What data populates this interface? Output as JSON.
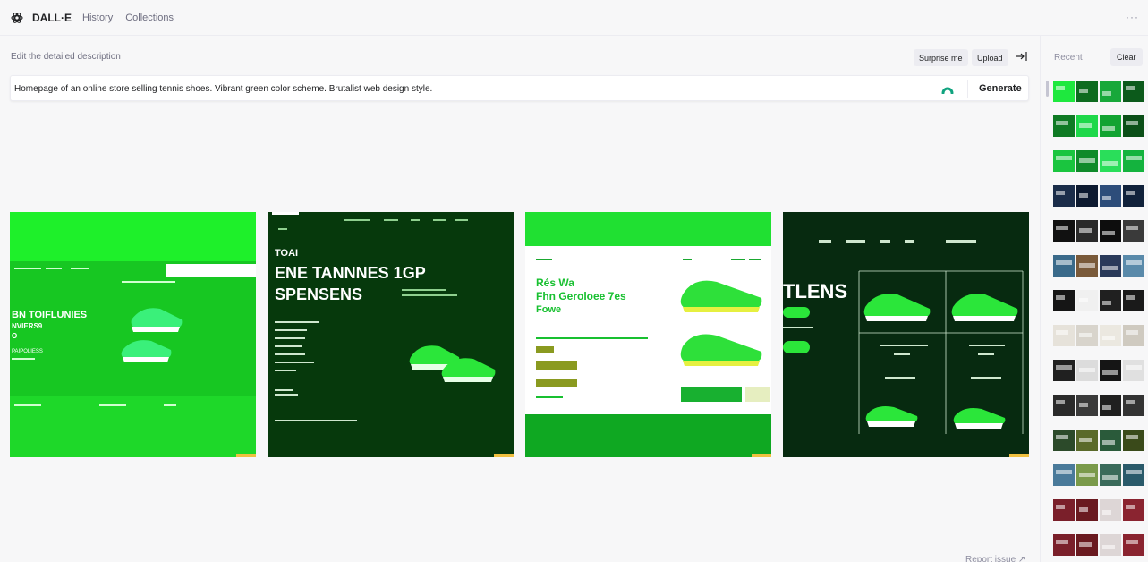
{
  "nav": {
    "brand": "DALL·E",
    "links": [
      "History",
      "Collections"
    ],
    "menu": "···"
  },
  "editor": {
    "label": "Edit the detailed description",
    "surprise_label": "Surprise me",
    "upload_label": "Upload",
    "prompt": "Homepage of an online store selling tennis shoes. Vibrant green color scheme. Brutalist web design style.",
    "generate_label": "Generate"
  },
  "results": [
    {
      "name": "result-1",
      "texts": [
        "BN TOIFLUNIES",
        "NVIERS9",
        "O",
        "PAIPOLIESS"
      ]
    },
    {
      "name": "result-2",
      "texts": [
        "TOAI",
        "ENE TANNNES 1GP",
        "SPENSENS"
      ]
    },
    {
      "name": "result-3",
      "texts": [
        "Rés Wa",
        "Fhn Geroloee 7es",
        "Fowe"
      ]
    },
    {
      "name": "result-4",
      "texts": [
        "TLENS"
      ]
    }
  ],
  "footer": {
    "report_label": "Report issue"
  },
  "sidebar": {
    "recent_label": "Recent",
    "clear_label": "Clear",
    "history": [
      [
        "#1ee83e",
        "#0d6b1f",
        "#18a83a",
        "#0c5a1b"
      ],
      [
        "#0f7a24",
        "#1ed84a",
        "#12a332",
        "#0b4f18"
      ],
      [
        "#1ac53f",
        "#0f8a2a",
        "#2ade5a",
        "#14b33e"
      ],
      [
        "#1b2d4a",
        "#0d1a30",
        "#2d4d7a",
        "#11223b"
      ],
      [
        "#111111",
        "#2a2a2a",
        "#0d0d0d",
        "#3a3a3a"
      ],
      [
        "#3a6a8a",
        "#7a5a3a",
        "#2a3a5a",
        "#5a8aaa"
      ],
      [
        "#151515",
        "#f0f0f0",
        "#202020",
        "#1a1a1a"
      ],
      [
        "#e6e2da",
        "#d8d4cc",
        "#ebe8e0",
        "#cfcac0"
      ],
      [
        "#202020",
        "#dcdcdc",
        "#151515",
        "#e0e0e0"
      ],
      [
        "#2a2a2a",
        "#3a3a3a",
        "#1f1f1f",
        "#333333"
      ],
      [
        "#2c4a2a",
        "#5a6a2a",
        "#2a5a3a",
        "#3a4a1a"
      ],
      [
        "#4a7a9a",
        "#7a9a4a",
        "#3a6a5a",
        "#2a5a6a"
      ],
      [
        "#7a1f2a",
        "#6a1a20",
        "#ddd6d6",
        "#8a2430"
      ],
      [
        "#7a1f2a",
        "#6a1a20",
        "#ddd6d6",
        "#8a2430"
      ]
    ]
  }
}
